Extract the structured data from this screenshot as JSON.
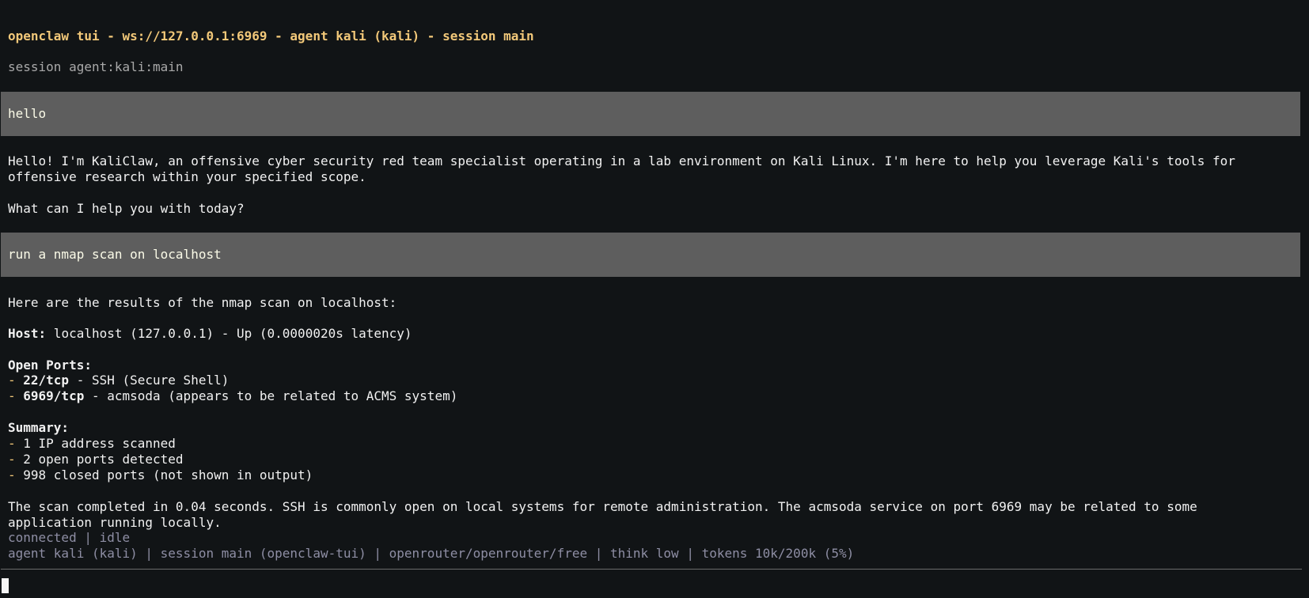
{
  "header": {
    "title": "openclaw tui - ws://127.0.0.1:6969 - agent kali (kali) - session main",
    "session_line": "session agent:kali:main"
  },
  "messages": [
    {
      "role": "user",
      "text": "hello"
    },
    {
      "role": "assistant",
      "lines": [
        "Hello! I'm KaliClaw, an offensive cyber security red team specialist operating in a lab environment on Kali Linux. I'm here to help you leverage Kali's tools for",
        "offensive research within your specified scope.",
        "What can I help you with today?"
      ]
    },
    {
      "role": "user",
      "text": "run a nmap scan on localhost"
    },
    {
      "role": "assistant",
      "intro": "Here are the results of the nmap scan on localhost:",
      "host_label": "Host:",
      "host_value": " localhost (127.0.0.1) - Up (0.0000020s latency)",
      "open_ports_label": "Open Ports:",
      "ports": [
        {
          "port": "22/tcp",
          "desc": " - SSH (Secure Shell)"
        },
        {
          "port": "6969/tcp",
          "desc": " - acmsoda (appears to be related to ACMS system)"
        }
      ],
      "summary_label": "Summary:",
      "summary": [
        "1 IP address scanned",
        "2 open ports detected",
        "998 closed ports (not shown in output)"
      ],
      "closing": [
        "The scan completed in 0.04 seconds. SSH is commonly open on local systems for remote administration. The acmsoda service on port 6969 may be related to some",
        "application running locally."
      ]
    }
  ],
  "bullet": "- ",
  "status": {
    "connection": "connected | idle",
    "info": "agent kali (kali) | session main (openclaw-tui) | openrouter/openrouter/free | think low | tokens 10k/200k (5%)"
  },
  "input": {
    "value": ""
  },
  "colors": {
    "background": "#111416",
    "title": "#f2c879",
    "user_block": "#5e5e5e",
    "status": "#8e8ea4"
  }
}
